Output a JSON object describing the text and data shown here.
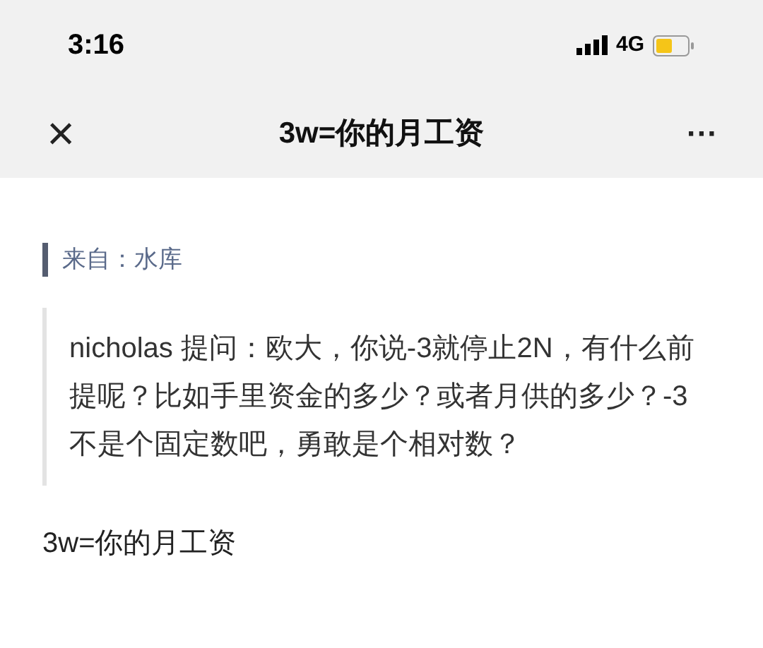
{
  "status_bar": {
    "time": "3:16",
    "network": "4G"
  },
  "nav_bar": {
    "close": "×",
    "title": "3w=你的月工资",
    "more": "···"
  },
  "source": {
    "label": "来自：水库"
  },
  "quote": {
    "text": "nicholas 提问：欧大，你说-3就停止2N，有什么前提呢？比如手里资金的多少？或者月供的多少？-3不是个固定数吧，勇敢是个相对数？"
  },
  "body": {
    "text": "3w=你的月工资"
  }
}
